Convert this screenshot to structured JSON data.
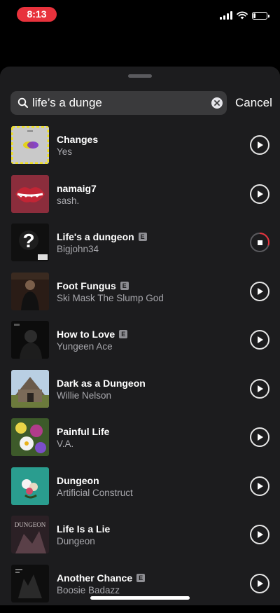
{
  "status_bar": {
    "time": "8:13",
    "battery_level": 0.2
  },
  "search": {
    "query": "life’s a dunge",
    "cancel_label": "Cancel"
  },
  "results": [
    {
      "title": "Changes",
      "artist": "Yes",
      "explicit": false,
      "state": "play",
      "art": "art-changes"
    },
    {
      "title": "namaig7",
      "artist": "sash.",
      "explicit": false,
      "state": "play",
      "art": "art-lips"
    },
    {
      "title": "Life's a dungeon",
      "artist": "Bigjohn34",
      "explicit": true,
      "state": "playing",
      "art": "art-question"
    },
    {
      "title": "Foot Fungus",
      "artist": "Ski Mask The Slump God",
      "explicit": true,
      "state": "play",
      "art": "art-portrait"
    },
    {
      "title": "How to Love",
      "artist": "Yungeen Ace",
      "explicit": true,
      "state": "play",
      "art": "art-dark"
    },
    {
      "title": "Dark as a Dungeon",
      "artist": "Willie Nelson",
      "explicit": false,
      "state": "play",
      "art": "art-barn"
    },
    {
      "title": "Painful Life",
      "artist": "V.A.",
      "explicit": false,
      "state": "play",
      "art": "art-flowers"
    },
    {
      "title": "Dungeon",
      "artist": "Artificial Construct",
      "explicit": false,
      "state": "play",
      "art": "art-teal"
    },
    {
      "title": "Life Is a Lie",
      "artist": "Dungeon",
      "explicit": false,
      "state": "play",
      "art": "art-dungeon"
    },
    {
      "title": "Another Chance",
      "artist": "Boosie Badazz",
      "explicit": true,
      "state": "play",
      "art": "art-black"
    }
  ],
  "playback_progress": 0.3,
  "explicit_label": "E",
  "colors": {
    "sheet": "#1c1c1e",
    "time_pill": "#e8323c",
    "secondary_text": "#a8a8ad",
    "progress": "#e8323c"
  }
}
